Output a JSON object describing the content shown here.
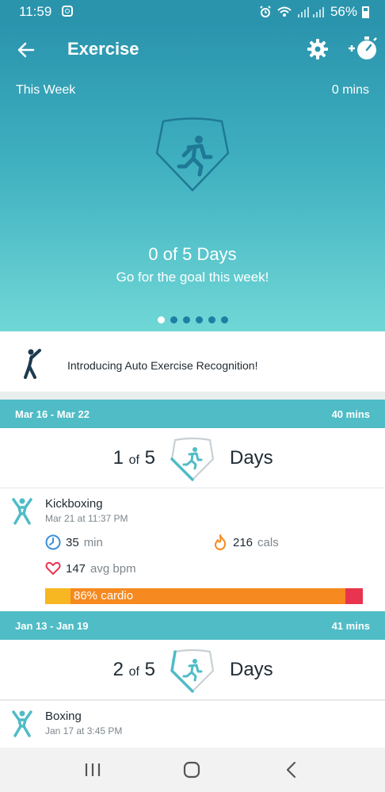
{
  "status_bar": {
    "time": "11:59",
    "battery": "56%"
  },
  "header": {
    "title": "Exercise"
  },
  "this_week": {
    "label": "This Week",
    "mins": "0 mins",
    "days_text": "0 of 5 Days",
    "subtitle": "Go for the goal this week!"
  },
  "carousel": {
    "dots": [
      true,
      false,
      false,
      false,
      false,
      false
    ]
  },
  "intro_banner": {
    "text": "Introducing Auto Exercise Recognition!"
  },
  "weeks": [
    {
      "range": "Mar 16 - Mar 22",
      "mins": "40 mins",
      "count": "1",
      "of": "of",
      "goal": "5",
      "days_label": "Days",
      "progress": 0.2,
      "activity": {
        "name": "Kickboxing",
        "date": "Mar 21 at 11:37 PM",
        "duration_value": "35",
        "duration_unit": "min",
        "calories_value": "216",
        "calories_unit": "cals",
        "bpm_value": "147",
        "bpm_unit": "avg bpm",
        "cardio_label": "86% cardio",
        "cardio_pct": 86
      }
    },
    {
      "range": "Jan 13 - Jan 19",
      "mins": "41 mins",
      "count": "2",
      "of": "of",
      "goal": "5",
      "days_label": "Days",
      "progress": 0.4,
      "activity": {
        "name": "Boxing",
        "date": "Jan 17 at 3:45 PM"
      }
    }
  ],
  "colors": {
    "header": "#2a94ad",
    "accent": "#4fbcc6",
    "fat_burn": "#f7b722",
    "cardio": "#f6891f",
    "peak": "#e8344f"
  }
}
